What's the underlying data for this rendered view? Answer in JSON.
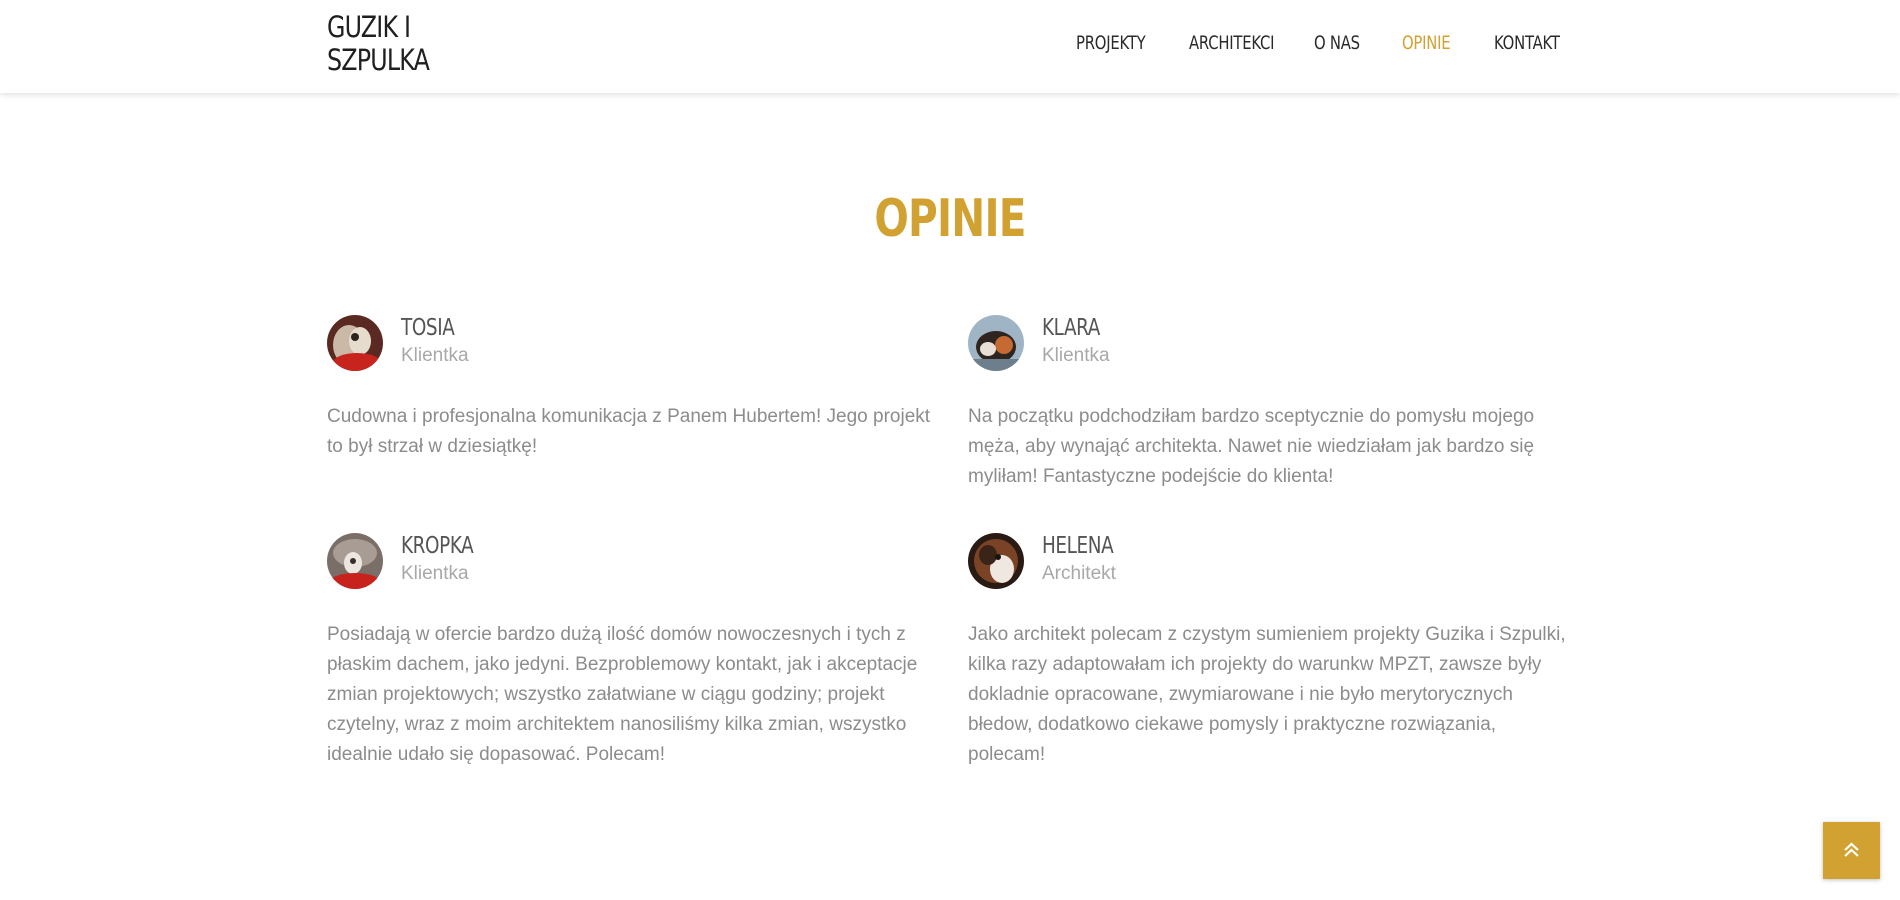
{
  "header": {
    "logo": "GUZIK I\nSZPULKA",
    "nav": [
      {
        "label": "PROJEKTY",
        "active": false
      },
      {
        "label": "ARCHITEKCI",
        "active": false
      },
      {
        "label": "O NAS",
        "active": false
      },
      {
        "label": "OPINIE",
        "active": true
      },
      {
        "label": "KONTAKT",
        "active": false
      }
    ]
  },
  "section": {
    "title": "OPINIE"
  },
  "testimonials": [
    {
      "name": "TOSIA",
      "role": "Klientka",
      "text": "Cudowna i profesjonalna komunikacja z Panem Hubertem! Jego projekt to był strzał w dziesiątkę!",
      "avatar_icon": "cat-photo-avatar"
    },
    {
      "name": "KLARA",
      "role": "Klientka",
      "text": "Na początku podchodziłam bardzo sceptycznie do pomysłu mojego męża, aby wynająć architekta. Nawet nie wiedziałam jak bardzo się myliłam! Fantastyczne podejście do klienta!",
      "avatar_icon": "cat-photo-avatar"
    },
    {
      "name": "KROPKA",
      "role": "Klientka",
      "text": "Posiadają w ofercie bardzo dużą ilość domów nowoczesnych i tych z płaskim dachem, jako jedyni. Bezproblemowy kontakt, jak i akceptacje zmian projektowych; wszystko załatwiane w ciągu godziny; projekt czytelny, wraz z moim architektem nanosiliśmy kilka zmian, wszystko idealnie udało się dopasować. Polecam!",
      "avatar_icon": "cat-photo-avatar"
    },
    {
      "name": "HELENA",
      "role": "Architekt",
      "text": "Jako architekt polecam z czystym sumieniem projekty Guzika i Szpulki, kilka razy adaptowałam ich projekty do warunkw MPZT, zawsze były dokladnie opracowane, zwymiarowane i nie było merytorycznych błedow, dodatkowo ciekawe pomysly i praktyczne rozwiązania, polecam!",
      "avatar_icon": "cat-photo-avatar"
    }
  ],
  "scroll_top": {
    "icon": "double-chevron-up-icon"
  },
  "colors": {
    "accent": "#d1a232",
    "heading_text": "#555555",
    "body_text": "#8c8c8c",
    "muted_text": "#a8a8a8"
  }
}
